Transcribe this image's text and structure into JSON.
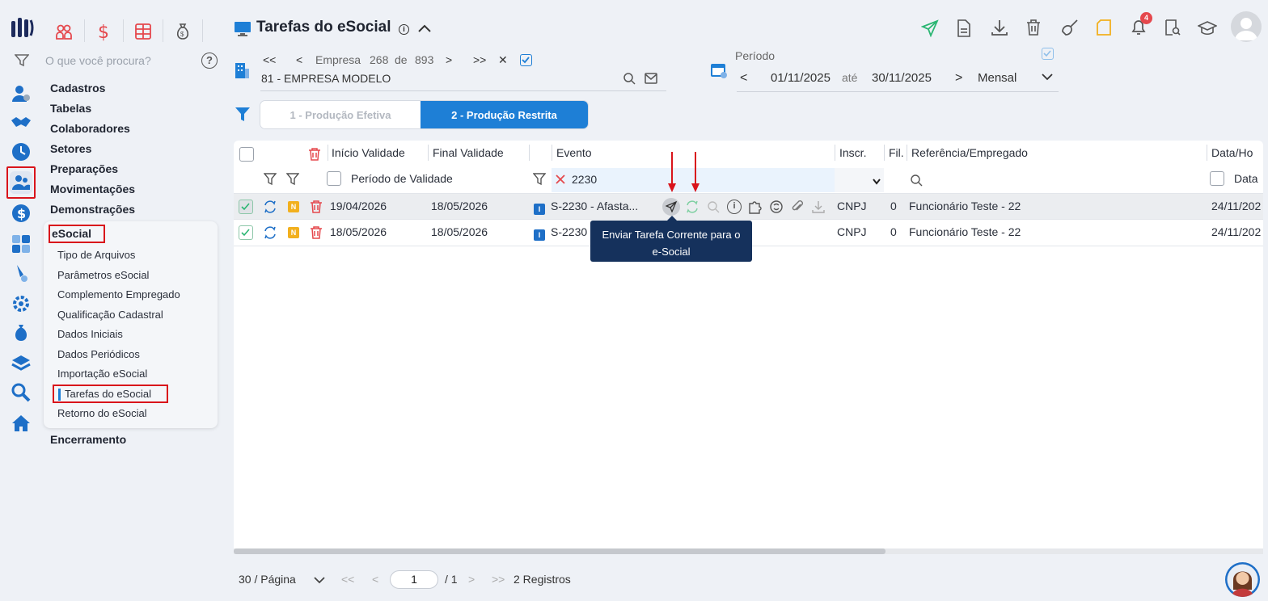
{
  "app": {
    "search_placeholder": "O que você procura?",
    "help": "?",
    "title": "Tarefas do eSocial",
    "notification_count": "4"
  },
  "menu": {
    "items": [
      "Cadastros",
      "Tabelas",
      "Colaboradores",
      "Setores",
      "Preparações",
      "Movimentações",
      "Demonstrações"
    ],
    "esocial": "eSocial",
    "submenu": [
      "Tipo de Arquivos",
      "Parâmetros eSocial",
      "Complemento Empregado",
      "Qualificação Cadastral",
      "Dados Iniciais",
      "Dados Periódicos",
      "Importação eSocial",
      "Tarefas do eSocial",
      "Retorno do eSocial"
    ],
    "encerramento": "Encerramento"
  },
  "company": {
    "first": "<<",
    "prev": "<",
    "label": "Empresa",
    "current": "268",
    "of": "de",
    "total": "893",
    "next": ">",
    "last": ">>",
    "close": "✕",
    "name": "81 - EMPRESA MODELO"
  },
  "period": {
    "label": "Período",
    "start": "01/11/2025",
    "until": "até",
    "end": "30/11/2025",
    "mode": "Mensal",
    "prev": "<",
    "next": ">"
  },
  "tabs": [
    "1 - Produção Efetiva",
    "2 - Produção Restrita"
  ],
  "grid": {
    "headers": {
      "inicio": "Início Validade",
      "final": "Final Validade",
      "evento": "Evento",
      "inscr": "Inscr.",
      "fil": "Fil.",
      "ref": "Referência/Empregado",
      "data": "Data/Ho"
    },
    "filters": {
      "periodo": "Período de Validade",
      "evento_value": "2230",
      "data": "Data"
    },
    "rows": [
      {
        "n": "N",
        "inicio": "19/04/2026",
        "final": "18/05/2026",
        "tipo": "I",
        "evento": "S-2230 - Afasta...",
        "inscr": "CNPJ",
        "fil": "0",
        "ref": "Funcionário Teste - 22",
        "data": "24/11/202"
      },
      {
        "n": "N",
        "inicio": "18/05/2026",
        "final": "18/05/2026",
        "tipo": "I",
        "evento": "S-2230",
        "inscr": "CNPJ",
        "fil": "0",
        "ref": "Funcionário Teste - 22",
        "data": "24/11/202"
      }
    ]
  },
  "tooltip": {
    "line1": "Enviar Tarefa Corrente para o",
    "line2": "e-Social"
  },
  "footer": {
    "per_page": "30 / Página",
    "first": "<<",
    "prev": "<",
    "page": "1",
    "total_pages": "/ 1",
    "next": ">",
    "last": ">>",
    "records": "2 Registros"
  },
  "colors": {
    "accent": "#1e7fd6",
    "danger": "#d9141b",
    "tooltip": "#15315c",
    "send_green": "#2bb673"
  }
}
